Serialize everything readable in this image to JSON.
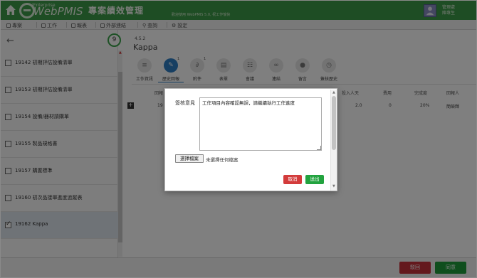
{
  "header": {
    "logo_small": "iEnterprise",
    "logo_text": "WebPMIS",
    "app_title": "專案績效管理",
    "subtitle": "歡迎使用 WebPMIS 5.0, 祝工作愉快",
    "user_line1": "管理處",
    "user_line2": "陳專生"
  },
  "menubar": {
    "items": [
      "專案",
      "工作",
      "報表",
      "外部連結",
      "查詢",
      "設定"
    ]
  },
  "sidebar": {
    "count": "9",
    "items": [
      {
        "label": "19142 初期評估設備清單",
        "checked": false
      },
      {
        "label": "19153 初期評估設備清單",
        "checked": false
      },
      {
        "label": "19154 設備/器材請購單",
        "checked": false
      },
      {
        "label": "19155 製品規格書",
        "checked": false
      },
      {
        "label": "19157 購置標準",
        "checked": false
      },
      {
        "label": "19160 初次品接單進度追蹤表",
        "checked": false
      },
      {
        "label": "19162 Kappa",
        "checked": true
      }
    ]
  },
  "main": {
    "breadcrumb": "4.5.2",
    "title": "Kappa",
    "tabs": [
      {
        "label": "工作資訊",
        "num": ""
      },
      {
        "label": "歷史回報",
        "num": "1"
      },
      {
        "label": "附件",
        "num": "1"
      },
      {
        "label": "表單",
        "num": ""
      },
      {
        "label": "會議",
        "num": ""
      },
      {
        "label": "連結",
        "num": ""
      },
      {
        "label": "留言",
        "num": ""
      },
      {
        "label": "簽核歷史",
        "num": ""
      }
    ],
    "table": {
      "headers": [
        "回報",
        "投入人天",
        "費用",
        "完成度",
        "回報人"
      ],
      "row": {
        "id": "19",
        "days": "2.0",
        "cost": "0",
        "progress": "20%",
        "reporter": "簡榮輝"
      }
    }
  },
  "modal": {
    "label": "簽核意見",
    "text": "工作項目內容確認無誤，請繼續執行工作進度",
    "file_button": "選擇檔案",
    "file_status": "未選擇任何檔案",
    "cancel": "取消",
    "submit": "送出"
  },
  "footer": {
    "back": "駁回",
    "agree": "同意"
  },
  "colors": {
    "header_green": "#3d9a48",
    "tab_active": "#2f7fc4",
    "danger": "#d33b3b",
    "success": "#22a33f"
  }
}
